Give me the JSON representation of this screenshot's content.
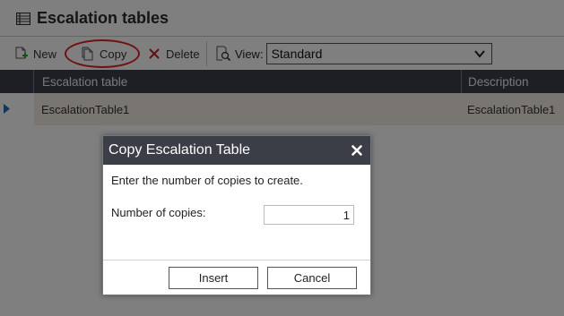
{
  "page": {
    "title": "Escalation tables",
    "title_icon": "table-list-icon"
  },
  "toolbar": {
    "new_label": "New",
    "copy_label": "Copy",
    "delete_label": "Delete",
    "view_label": "View:",
    "view_selected": "Standard",
    "icons": {
      "new": "new-document-icon",
      "copy": "copy-document-icon",
      "delete": "delete-x-icon",
      "view": "view-magnifier-icon"
    },
    "highlight_color": "#e02020"
  },
  "grid": {
    "columns": [
      "Escalation table",
      "Description"
    ],
    "rows": [
      {
        "name": "EscalationTable1",
        "description": "EscalationTable1",
        "selected": true
      }
    ],
    "header_bg": "#3c3e48",
    "selected_row_bg": "#f3ede2"
  },
  "dialog": {
    "title": "Copy Escalation Table",
    "message": "Enter the number of copies to create.",
    "field_label": "Number of copies:",
    "field_value": "1",
    "insert_label": "Insert",
    "cancel_label": "Cancel"
  }
}
